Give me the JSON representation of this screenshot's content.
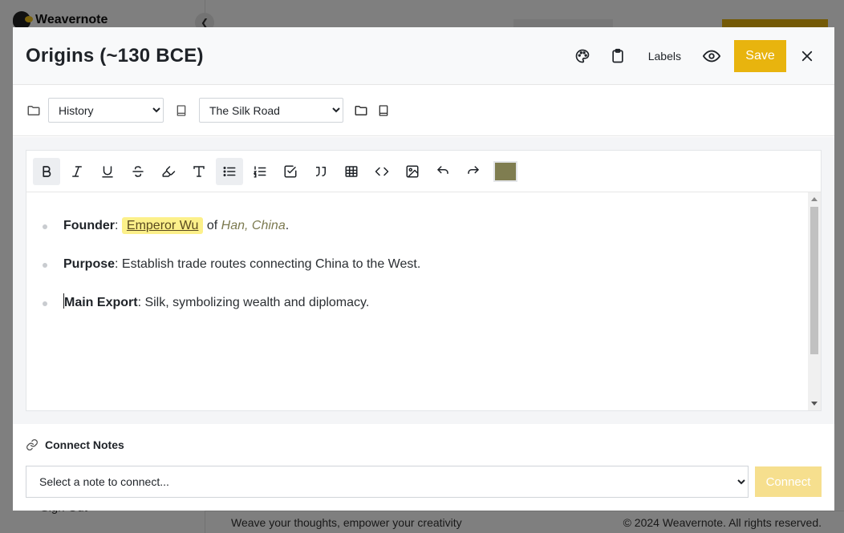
{
  "background": {
    "brand": "Weavernote",
    "sign_out": "Sign Out",
    "footer_left": "Weave your thoughts, empower your creativity",
    "footer_right": "© 2024 Weavernote. All rights reserved."
  },
  "modal": {
    "title": "Origins (~130 BCE)",
    "labels_button": "Labels",
    "save_button": "Save",
    "category_select": {
      "selected": "History",
      "options": [
        "History"
      ]
    },
    "notebook_select": {
      "selected": "The Silk Road",
      "options": [
        "The Silk Road"
      ]
    }
  },
  "toolbar": {
    "buttons": [
      "bold",
      "italic",
      "underline",
      "strikethrough",
      "highlight",
      "text-style",
      "bullet-list",
      "ordered-list",
      "task-list",
      "blockquote",
      "table",
      "code",
      "image",
      "undo",
      "redo"
    ],
    "active": [
      "bold",
      "bullet-list"
    ],
    "text_color": "#7f7d50"
  },
  "content": {
    "items": [
      {
        "label": "Founder",
        "sep": ":",
        "link": "Emperor Wu",
        "mid": "of",
        "place": "Han, China",
        "end": "."
      },
      {
        "label": "Purpose",
        "text": ": Establish trade routes connecting China to the West."
      },
      {
        "label": "Main Export",
        "text": ": Silk, symbolizing wealth and diplomacy."
      }
    ]
  },
  "connect": {
    "heading": "Connect Notes",
    "placeholder": "Select a note to connect...",
    "button": "Connect"
  },
  "colors": {
    "accent": "#e8b40e",
    "accent_disabled": "#f6df8e",
    "highlight": "#fcf08a"
  }
}
